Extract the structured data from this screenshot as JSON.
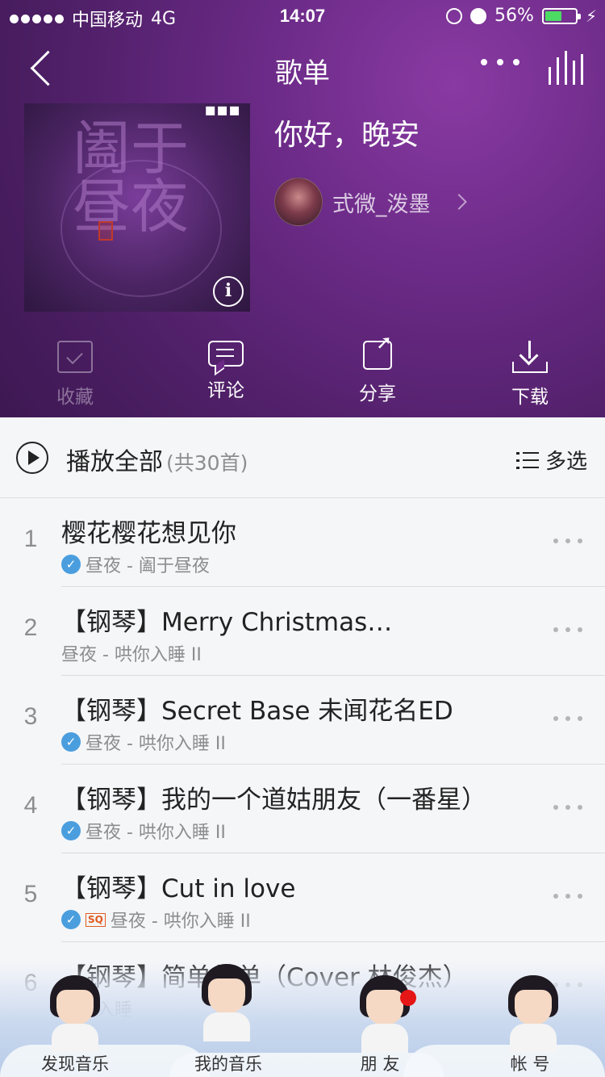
{
  "status": {
    "carrier": "中国移动",
    "network": "4G",
    "time": "14:07",
    "battery_text": "56%",
    "battery_level": 0.56,
    "battery_color": "#4cd964"
  },
  "nav": {
    "title": "歌单",
    "back_icon": "chevron-left-icon",
    "more_icon": "more-dots-icon",
    "playing_icon": "equalizer-icon"
  },
  "playlist": {
    "title": "你好，晚安",
    "creator": "式微_泼墨",
    "cover_art_text": "阖于昼夜"
  },
  "actions": [
    {
      "label": "收藏",
      "icon": "favorite-folder-icon"
    },
    {
      "label": "评论",
      "icon": "comment-icon"
    },
    {
      "label": "分享",
      "icon": "share-icon"
    },
    {
      "label": "下载",
      "icon": "download-icon"
    }
  ],
  "playall": {
    "label": "播放全部",
    "count": "(共30首)",
    "multi_select": "多选"
  },
  "songs": [
    {
      "index": "1",
      "title": "樱花樱花想见你",
      "verified": true,
      "sq": false,
      "sub": "昼夜 - 阖于昼夜"
    },
    {
      "index": "2",
      "title": "【钢琴】Merry Christmas…",
      "verified": false,
      "sq": false,
      "sub": "昼夜 - 哄你入睡 II"
    },
    {
      "index": "3",
      "title": "【钢琴】Secret Base 未闻花名ED",
      "verified": true,
      "sq": false,
      "sub": "昼夜 - 哄你入睡 II"
    },
    {
      "index": "4",
      "title": "【钢琴】我的一个道姑朋友（一番星）",
      "verified": true,
      "sq": false,
      "sub": "昼夜 - 哄你入睡 II"
    },
    {
      "index": "5",
      "title": "【钢琴】Cut in love",
      "verified": true,
      "sq": true,
      "sub": "昼夜 - 哄你入睡 II"
    },
    {
      "index": "6",
      "title": "【钢琴】简单单单（Cover 林俊杰）",
      "verified": false,
      "sq": false,
      "sub": "哄你入睡"
    }
  ],
  "badges": {
    "verified": "✓",
    "sq": "SQ"
  },
  "tabs": [
    {
      "label": "发现音乐"
    },
    {
      "label": "我的音乐"
    },
    {
      "label": "朋 友"
    },
    {
      "label": "帐 号"
    }
  ],
  "colors": {
    "header_purple": "#5b2476",
    "verified_blue": "#4a9ede",
    "sq_orange": "#e05a1e",
    "notification_red": "#e51616"
  }
}
